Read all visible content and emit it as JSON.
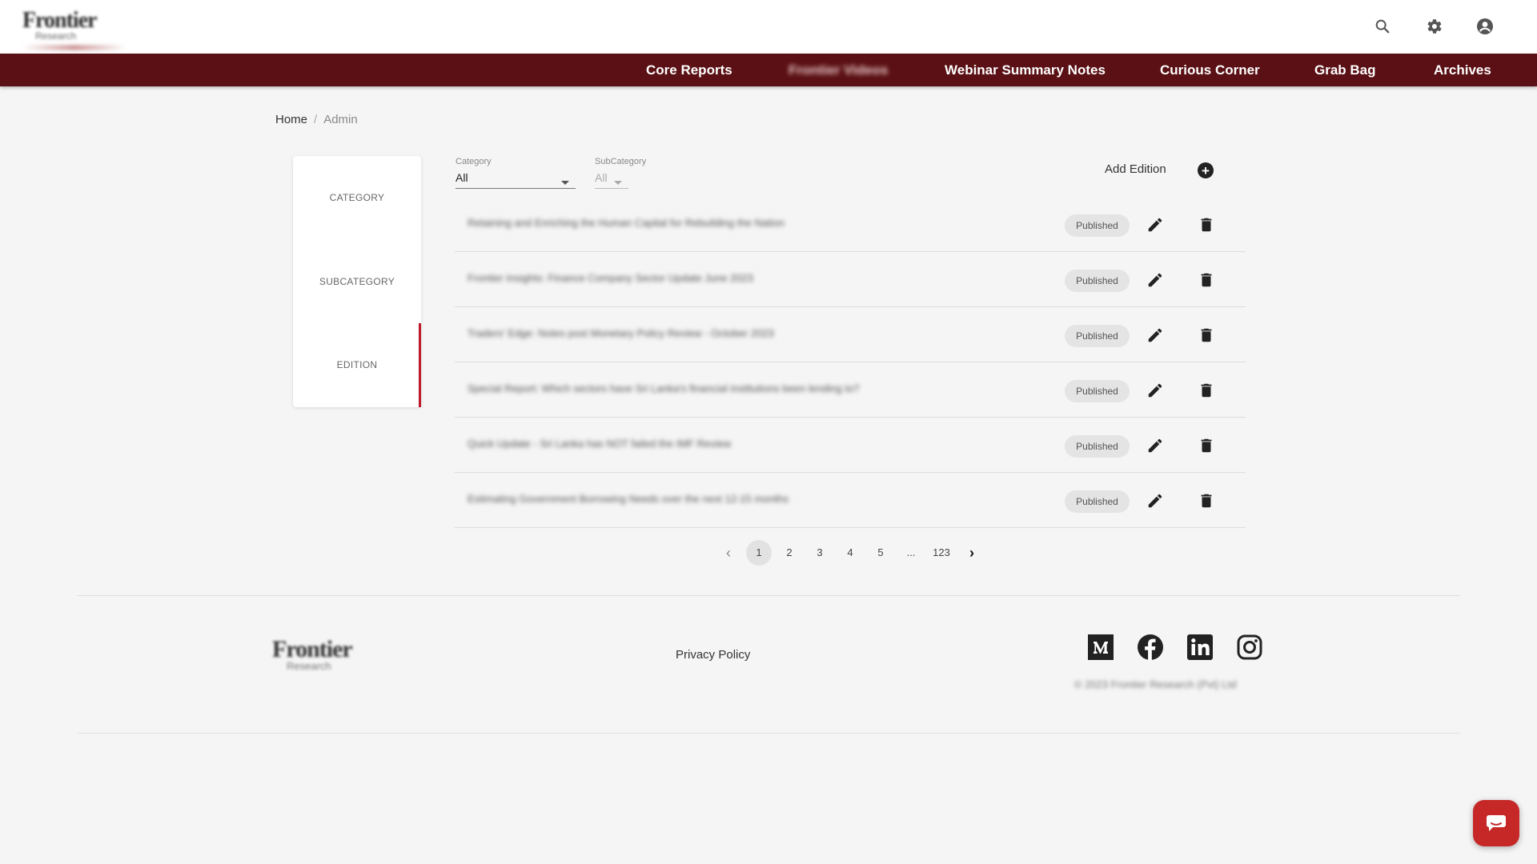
{
  "brand": {
    "logo_text": "Frontier",
    "logo_sub": "Research"
  },
  "topbar": {
    "icons": [
      "search-icon",
      "gear-icon",
      "account-icon"
    ]
  },
  "nav": {
    "items": [
      {
        "label": "Core Reports"
      },
      {
        "label": "Frontier Videos"
      },
      {
        "label": "Webinar Summary Notes"
      },
      {
        "label": "Curious Corner"
      },
      {
        "label": "Grab Bag"
      },
      {
        "label": "Archives"
      }
    ]
  },
  "breadcrumb": {
    "home": "Home",
    "sep": "/",
    "current": "Admin"
  },
  "sidemenu": {
    "items": [
      {
        "label": "CATEGORY"
      },
      {
        "label": "SUBCATEGORY"
      },
      {
        "label": "EDITION"
      }
    ],
    "active": "EDITION"
  },
  "filters": {
    "category": {
      "label": "Category",
      "value": "All"
    },
    "subcategory": {
      "label": "SubCategory",
      "value": "All"
    }
  },
  "actions": {
    "add_edition": "Add Edition",
    "add_symbol": "+"
  },
  "editions": [
    {
      "title": "Retaining and Enriching the Human Capital for Rebuilding the Nation",
      "status": "Published"
    },
    {
      "title": "Frontier Insights: Finance Company Sector Update June 2023",
      "status": "Published"
    },
    {
      "title": "Traders' Edge: Notes post Monetary Policy Review - October 2023",
      "status": "Published"
    },
    {
      "title": "Special Report: Which sectors have Sri Lanka's financial institutions been lending to?",
      "status": "Published"
    },
    {
      "title": "Quick Update - Sri Lanka has NOT failed the IMF Review",
      "status": "Published"
    },
    {
      "title": "Estimating Government Borrowing Needs over the next 12-15 months",
      "status": "Published"
    }
  ],
  "pagination": {
    "prev": "‹",
    "pages": [
      "1",
      "2",
      "3",
      "4",
      "5",
      "...",
      "123"
    ],
    "current": "1",
    "next": "›"
  },
  "footer": {
    "privacy": "Privacy Policy",
    "social": [
      "medium-icon",
      "facebook-icon",
      "linkedin-icon",
      "instagram-icon"
    ],
    "copyright": "© 2023 Frontier Research (Pvt) Ltd"
  },
  "colors": {
    "nav_bg": "#5a1014",
    "accent": "#c0182a",
    "chat_bg": "#c62828"
  }
}
